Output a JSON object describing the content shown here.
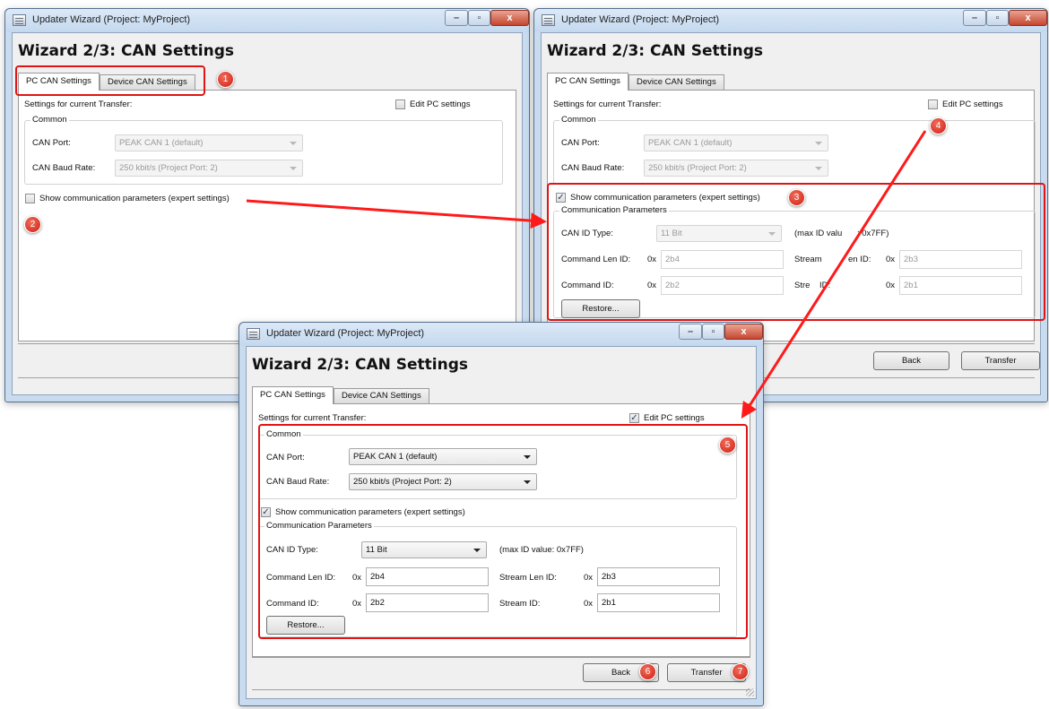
{
  "window": {
    "title": "Updater Wizard (Project: MyProject)",
    "heading": "Wizard 2/3:  CAN Settings",
    "controls": {
      "minimize": "–",
      "maximize": "▫",
      "close": "x"
    }
  },
  "tabs": {
    "pc": "PC CAN Settings",
    "device": "Device CAN Settings"
  },
  "settings": {
    "header": "Settings for current Transfer:",
    "edit_pc": "Edit PC settings",
    "common": "Common",
    "can_port_label": "CAN Port:",
    "can_port_value": "PEAK CAN 1 (default)",
    "baud_label": "CAN Baud Rate:",
    "baud_value": "250 kbit/s (Project Port: 2)",
    "show_params": "Show communication parameters (expert settings)"
  },
  "params": {
    "title": "Communication Parameters",
    "id_type_label": "CAN ID Type:",
    "id_type_value": "11 Bit",
    "max_id": "(max ID value:  0x7FF)",
    "max_id_w2_left": "(max ID valu",
    "max_id_w2_right": ":  0x7FF)",
    "cmd_len_label": "Command Len ID:",
    "cmd_id_label": "Command ID:",
    "stream_len_label": "Stream Len ID:",
    "stream_id_label": "Stream ID:",
    "stream_len_w2_left": "Stream ",
    "stream_len_w2_right": "en ID:",
    "stream_id_w2_left": "Stre",
    "stream_id_w2_right": "ID:",
    "hex_prefix": "0x",
    "cmd_len_value": "2b4",
    "cmd_value": "2b2",
    "stream_len_value": "2b3",
    "stream_value": "2b1",
    "restore": "Restore..."
  },
  "buttons": {
    "back": "Back",
    "transfer": "Transfer"
  },
  "markers": [
    "1",
    "2",
    "3",
    "4",
    "5",
    "6",
    "7"
  ],
  "colors": {
    "highlight": "#e01414",
    "arrow": "#ff1a1a"
  }
}
